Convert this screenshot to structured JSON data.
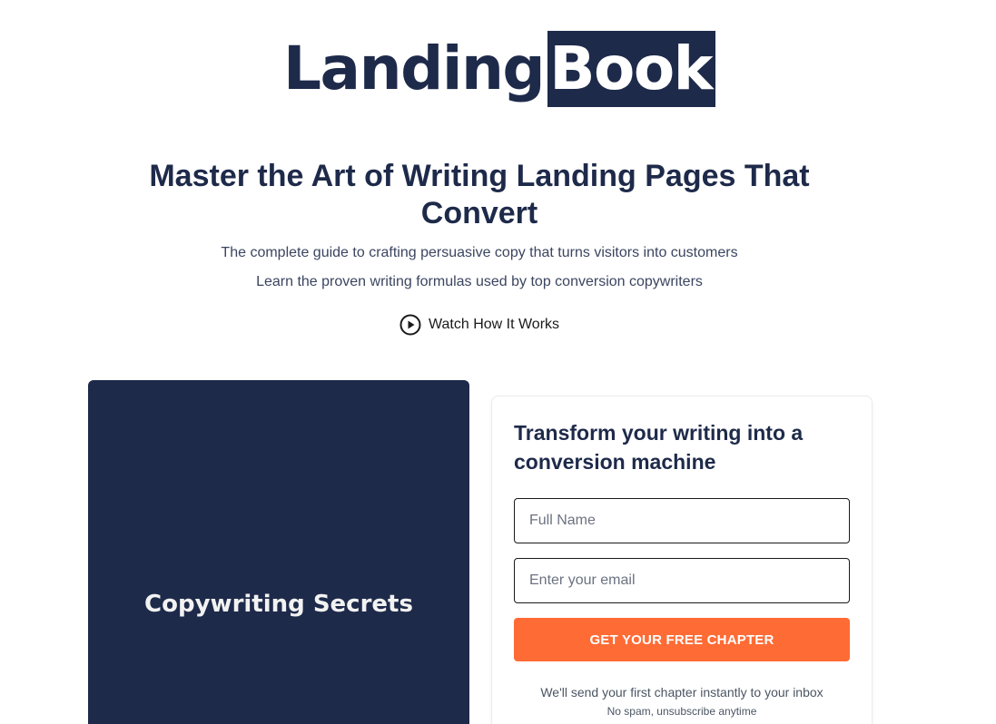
{
  "logo": {
    "part1": "Landing",
    "part2": "Book"
  },
  "hero": {
    "headline": "Master the Art of Writing Landing Pages That Convert",
    "subline1": "The complete guide to crafting persuasive copy that turns visitors into customers",
    "subline2": "Learn the proven writing formulas used by top conversion copywriters",
    "watch_label": "Watch How It Works",
    "watch_icon": "play-circle-icon"
  },
  "book": {
    "title": "Copywriting Secrets",
    "cover_color": "#1e2a4a"
  },
  "form": {
    "title": "Transform your writing into a conversion machine",
    "name_placeholder": "Full Name",
    "name_value": "",
    "email_placeholder": "Enter your email",
    "email_value": "",
    "cta_label": "GET YOUR FREE CHAPTER",
    "note": "We'll send your first chapter instantly to your inbox",
    "subnote": "No spam, unsubscribe anytime"
  },
  "colors": {
    "brand_navy": "#1e2a4a",
    "cta_orange": "#ff6b35"
  }
}
